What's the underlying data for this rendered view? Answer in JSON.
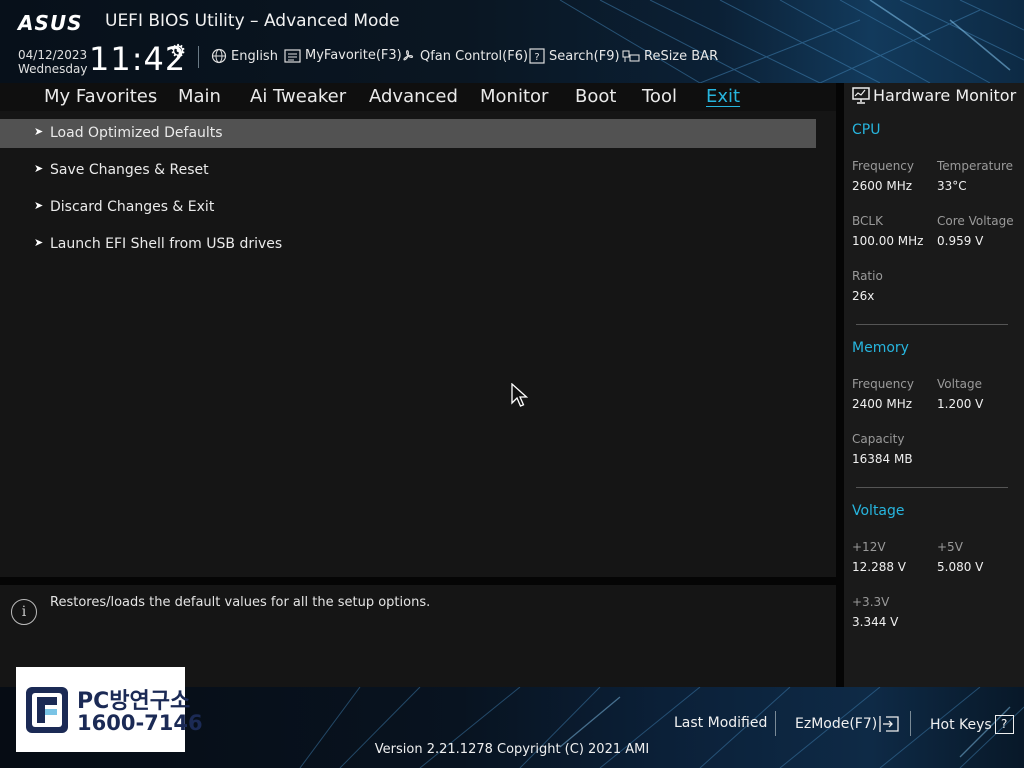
{
  "header": {
    "brand": "ASUS",
    "title": "UEFI BIOS Utility – Advanced Mode",
    "date": "04/12/2023",
    "weekday": "Wednesday",
    "time": "11:42",
    "tools": [
      {
        "label": "English",
        "icon": "globe-icon"
      },
      {
        "label": "MyFavorite(F3)",
        "icon": "favorite-list-icon"
      },
      {
        "label": "Qfan Control(F6)",
        "icon": "fan-icon"
      },
      {
        "label": "Search(F9)",
        "icon": "search-help-icon"
      },
      {
        "label": "ReSize BAR",
        "icon": "resize-bar-icon"
      }
    ]
  },
  "tabs": [
    {
      "label": "My Favorites"
    },
    {
      "label": "Main"
    },
    {
      "label": "Ai Tweaker"
    },
    {
      "label": "Advanced"
    },
    {
      "label": "Monitor"
    },
    {
      "label": "Boot"
    },
    {
      "label": "Tool"
    },
    {
      "label": "Exit",
      "active": true
    }
  ],
  "menu": [
    {
      "label": "Load Optimized Defaults",
      "selected": true
    },
    {
      "label": "Save Changes & Reset"
    },
    {
      "label": "Discard Changes & Exit"
    },
    {
      "label": "Launch EFI Shell from USB drives"
    }
  ],
  "info": {
    "text": "Restores/loads the default values for all the setup options."
  },
  "hardware_monitor": {
    "title": "Hardware Monitor",
    "cpu": {
      "heading": "CPU",
      "frequency_label": "Frequency",
      "frequency": "2600 MHz",
      "temperature_label": "Temperature",
      "temperature": "33°C",
      "bclk_label": "BCLK",
      "bclk": "100.00 MHz",
      "core_voltage_label": "Core Voltage",
      "core_voltage": "0.959 V",
      "ratio_label": "Ratio",
      "ratio": "26x"
    },
    "memory": {
      "heading": "Memory",
      "frequency_label": "Frequency",
      "frequency": "2400 MHz",
      "voltage_label": "Voltage",
      "voltage": "1.200 V",
      "capacity_label": "Capacity",
      "capacity": "16384 MB"
    },
    "voltage": {
      "heading": "Voltage",
      "v12_label": "+12V",
      "v12": "12.288 V",
      "v5_label": "+5V",
      "v5": "5.080 V",
      "v33_label": "+3.3V",
      "v33": "3.344 V"
    }
  },
  "footer": {
    "last_modified": "Last Modified",
    "ezmode": "EzMode(F7)",
    "hot_keys": "Hot Keys",
    "hot_keys_glyph": "?",
    "version": "Version 2.21.1278 Copyright (C) 2021 AMI"
  },
  "watermark": {
    "line1": "PC방연구소",
    "line2": "1600-7146"
  },
  "colors": {
    "accent": "#27b5de",
    "selected_row": "#525252",
    "panel": "#1a1a1a"
  }
}
